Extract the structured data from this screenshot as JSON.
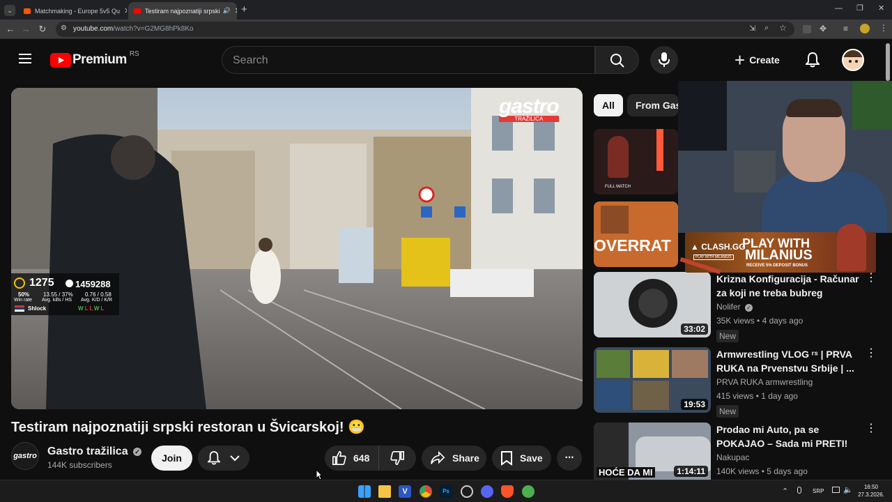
{
  "browser": {
    "tabs": [
      {
        "label": "Matchmaking - Europe 5v5 Qu",
        "active": false
      },
      {
        "label": "Testiram najpoznatiji srpski",
        "active": true
      }
    ],
    "url_host": "youtube.com",
    "url_path": "/watch?v=G2MG8hPk8Ko"
  },
  "header": {
    "logo": "Premium",
    "region": "RS",
    "search_placeholder": "Search",
    "create_label": "Create"
  },
  "video": {
    "channel_watermark": "gastro",
    "watermark_sub": "TRAŽILICA",
    "title": "Testiram najpoznatiji srpski restoran u Švicarskoj! 😬",
    "channel": "Gastro tražilica",
    "subscribers": "144K subscribers",
    "join_label": "Join",
    "likes": "648",
    "share_label": "Share",
    "save_label": "Save",
    "more_label": "···"
  },
  "stats_overlay": {
    "level": "1275",
    "elo": "1459288",
    "winrate": "50%",
    "winrate_label": "Win rate",
    "kills": "13.55 / 37%",
    "kills_label": "Avg. kills / HS",
    "kd": "0.76 / 0.58",
    "kd_label": "Avg. K/D / K/R",
    "player": "Shlock",
    "results": [
      "W",
      "L",
      "L",
      "W",
      "L"
    ]
  },
  "filters": [
    "All",
    "From Gas"
  ],
  "recommendations": [
    {
      "thumb_text": "FULL MATCH",
      "title": "",
      "channel": "",
      "meta": "",
      "new": false,
      "duration": ""
    },
    {
      "thumb_text": "OVERRAT",
      "title": "",
      "channel": "",
      "meta": "",
      "new": false,
      "duration": ""
    },
    {
      "title": "Krizna Konfiguracija - Računar za koji ne treba bubreg",
      "channel": "Nolifer",
      "views": "35K views",
      "age": "4 days ago",
      "new": true,
      "duration": "33:02"
    },
    {
      "title": "Armwrestling VLOG ʳˢ | PRVA RUKA na Prvenstvu Srbije | ...",
      "channel": "PRVA RUKA armwrestling",
      "views": "415 views",
      "age": "1 day ago",
      "new": true,
      "duration": "19:53"
    },
    {
      "title": "Prodao mi Auto, pa se POKAJAO – Sada mi PRETI!",
      "channel": "Nakupac",
      "views": "140K views",
      "age": "5 days ago",
      "new": false,
      "duration": "1:14:11",
      "thumb_text": "HOĆE DA MI"
    }
  ],
  "new_label": "New",
  "promo": {
    "brand": "CLASH.GG",
    "headline": "PLAY WITH",
    "name": "MILANIUS",
    "small": "PLAY WITH MILANIUS",
    "bonus": "RECEIVE 5% DEPOSIT BONUS"
  },
  "taskbar": {
    "lang": "SRP",
    "time": "16:50",
    "date": "27.3.2026."
  },
  "colors": {
    "yt_red": "#ff0000",
    "bg": "#0f0f0f",
    "chip_active": "#f1f1f1"
  }
}
